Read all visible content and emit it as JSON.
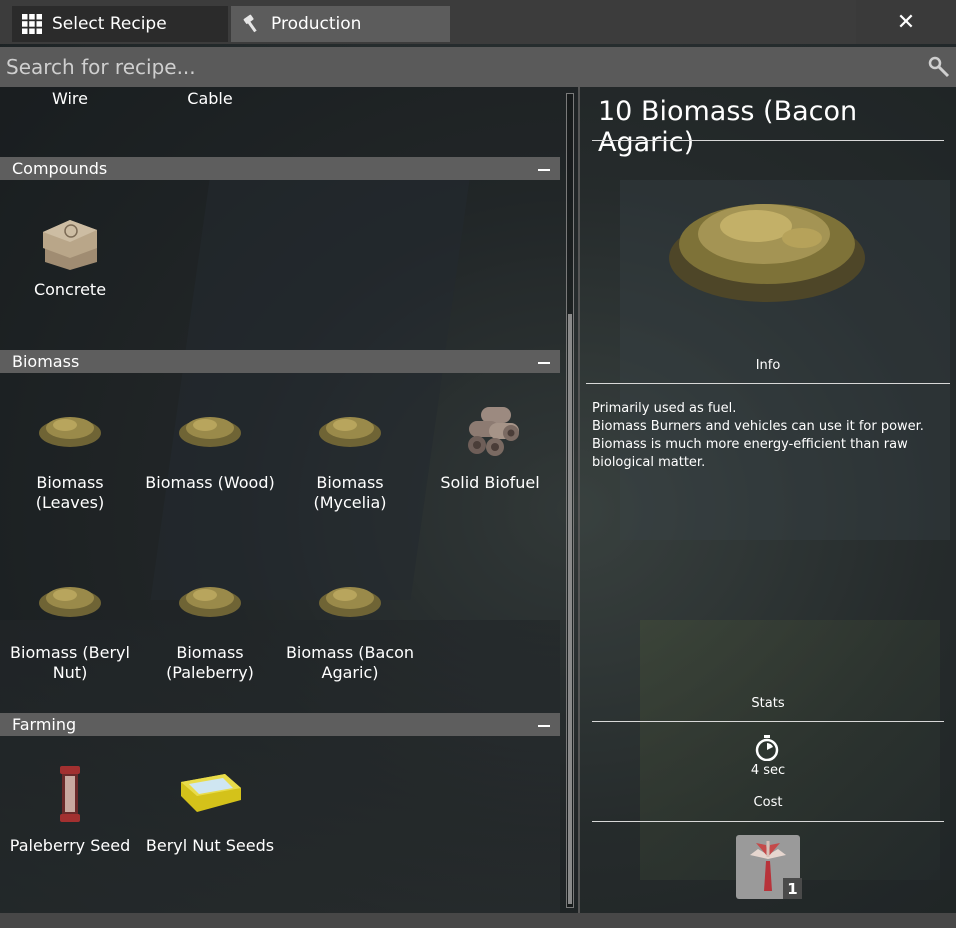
{
  "tabs": [
    {
      "label": "Select Recipe",
      "icon": "grid-icon"
    },
    {
      "label": "Production",
      "icon": "hammer-icon"
    }
  ],
  "close_label": "✕",
  "search": {
    "placeholder": "Search for recipe...",
    "value": "",
    "icon": "search-icon"
  },
  "top_items": [
    "Wire",
    "Cable"
  ],
  "categories": [
    {
      "name": "Compounds",
      "items": [
        "Concrete"
      ]
    },
    {
      "name": "Biomass",
      "items": [
        "Biomass (Leaves)",
        "Biomass (Wood)",
        "Biomass (Mycelia)",
        "Solid Biofuel",
        "Biomass (Beryl Nut)",
        "Biomass (Paleberry)",
        "Biomass (Bacon Agaric)"
      ]
    },
    {
      "name": "Farming",
      "items": [
        "Paleberry Seed",
        "Beryl Nut Seeds"
      ]
    }
  ],
  "detail": {
    "title": "10  Biomass (Bacon Agaric)",
    "info_label": "Info",
    "description": [
      "Primarily used as fuel.",
      "Biomass Burners and vehicles can use it for power.",
      "Biomass is much more energy-efficient than raw biological matter."
    ],
    "stats_label": "Stats",
    "time": "4 sec",
    "cost_label": "Cost",
    "cost_count": "1"
  },
  "colors": {
    "panel_dark": "#2b2b2b",
    "tab_active": "#5c5c5c",
    "header": "#5e5e5e"
  }
}
